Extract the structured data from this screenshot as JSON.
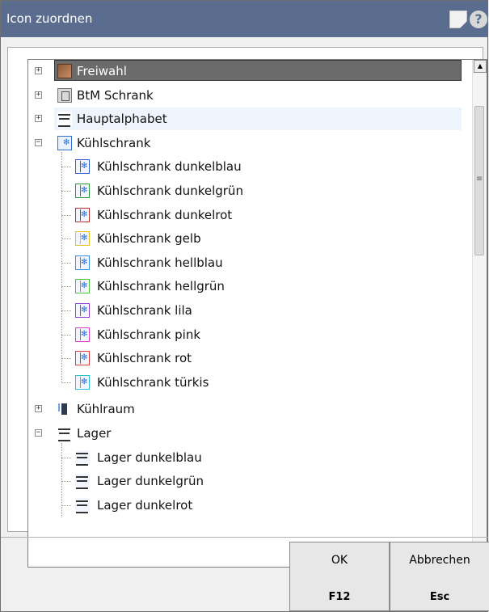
{
  "window": {
    "title": "Icon zuordnen"
  },
  "tree": {
    "items": [
      {
        "label": "Freiwahl",
        "icon": "freiwahl-icon",
        "expander": "+",
        "selected": true
      },
      {
        "label": "BtM Schrank",
        "icon": "btm-cabinet-icon",
        "expander": "+"
      },
      {
        "label": "Hauptalphabet",
        "icon": "shelf-icon",
        "expander": "+"
      },
      {
        "label": "Kühlschrank",
        "icon": "fridge-icon",
        "expander": "−"
      }
    ],
    "fridge_children": [
      {
        "label": "Kühlschrank dunkelblau",
        "color": "#2f5ed0"
      },
      {
        "label": "Kühlschrank dunkelgrün",
        "color": "#2f9a3a"
      },
      {
        "label": "Kühlschrank dunkelrot",
        "color": "#b83232"
      },
      {
        "label": "Kühlschrank gelb",
        "color": "#e6c21a"
      },
      {
        "label": "Kühlschrank hellblau",
        "color": "#3a8fe0"
      },
      {
        "label": "Kühlschrank hellgrün",
        "color": "#52c23a"
      },
      {
        "label": "Kühlschrank lila",
        "color": "#9a3fd0"
      },
      {
        "label": "Kühlschrank pink",
        "color": "#e040c0"
      },
      {
        "label": "Kühlschrank rot",
        "color": "#e03a3a"
      },
      {
        "label": "Kühlschrank türkis",
        "color": "#22c2d0"
      }
    ],
    "more_items": [
      {
        "label": "Kühlraum",
        "icon": "cold-room-icon",
        "expander": "+"
      },
      {
        "label": "Lager",
        "icon": "shelf-icon",
        "expander": "−"
      }
    ],
    "lager_children": [
      {
        "label": "Lager dunkelblau",
        "color": "#2f5ed0"
      },
      {
        "label": "Lager dunkelgrün",
        "color": "#2f9a3a"
      },
      {
        "label": "Lager dunkelrot",
        "color": "#b83232"
      }
    ]
  },
  "buttons": {
    "ok": {
      "label": "OK",
      "key": "F12"
    },
    "cancel": {
      "label": "Abbrechen",
      "key": "Esc"
    }
  }
}
